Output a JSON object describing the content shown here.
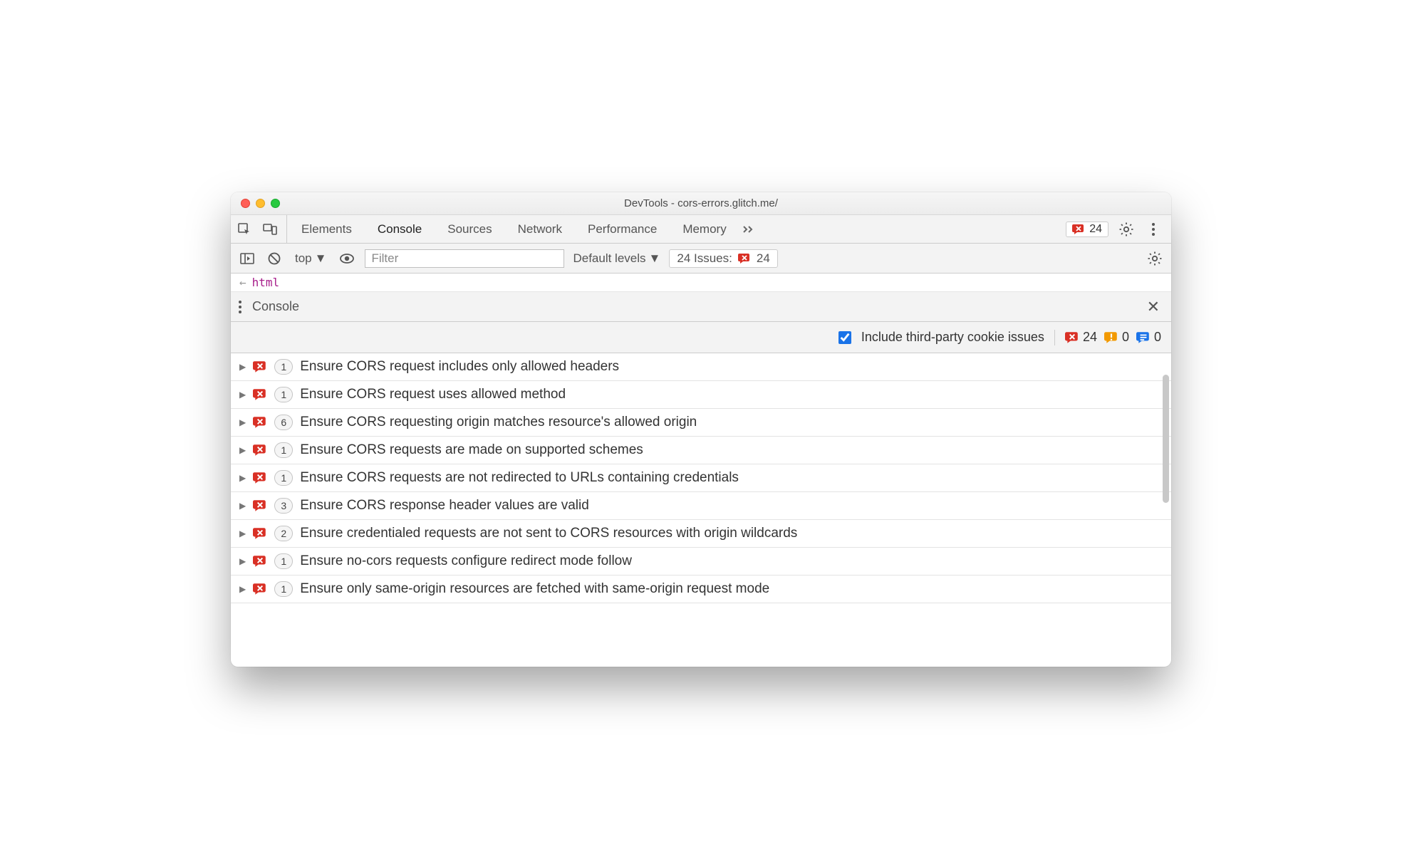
{
  "window_title": "DevTools - cors-errors.glitch.me/",
  "tabs": {
    "items": [
      "Elements",
      "Console",
      "Sources",
      "Network",
      "Performance",
      "Memory"
    ],
    "active": "Console",
    "error_count": "24"
  },
  "subbar": {
    "context": "top",
    "filter_placeholder": "Filter",
    "levels_label": "Default levels",
    "issues_label": "24 Issues:",
    "issues_count": "24"
  },
  "hint_tag": "html",
  "drawer_label": "Console",
  "issues_toolbar": {
    "checkbox_label": "Include third-party cookie issues",
    "error_count": "24",
    "warn_count": "0",
    "info_count": "0"
  },
  "issues": [
    {
      "count": "1",
      "title": "Ensure CORS request includes only allowed headers"
    },
    {
      "count": "1",
      "title": "Ensure CORS request uses allowed method"
    },
    {
      "count": "6",
      "title": "Ensure CORS requesting origin matches resource's allowed origin"
    },
    {
      "count": "1",
      "title": "Ensure CORS requests are made on supported schemes"
    },
    {
      "count": "1",
      "title": "Ensure CORS requests are not redirected to URLs containing credentials"
    },
    {
      "count": "3",
      "title": "Ensure CORS response header values are valid"
    },
    {
      "count": "2",
      "title": "Ensure credentialed requests are not sent to CORS resources with origin wildcards"
    },
    {
      "count": "1",
      "title": "Ensure no-cors requests configure redirect mode follow"
    },
    {
      "count": "1",
      "title": "Ensure only same-origin resources are fetched with same-origin request mode"
    }
  ]
}
